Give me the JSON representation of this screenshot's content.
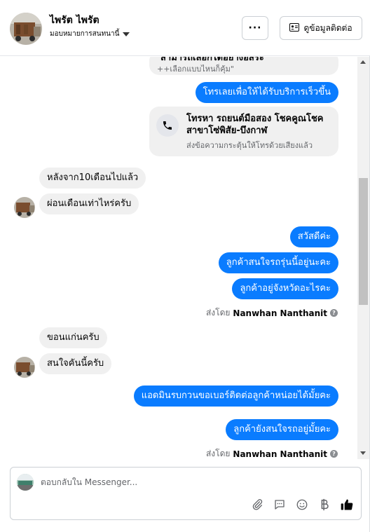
{
  "header": {
    "name": "ไพรัต ไพรัต",
    "assign_label": "มอบหมายการสนทนานี้",
    "more_label": "···",
    "contact_label": "ดูข้อมูลติดต่อ"
  },
  "messages": {
    "top_card": {
      "title_partial": "สามารถเลือกได้อย่างอิสระ",
      "subtitle": "++เลือกแบบไหนก็คุ้ม\""
    },
    "call_prompt": "โทรเลยเพื่อให้ได้รับบริการเร็วขึ้น",
    "call_card": {
      "title": "โทรหา รถยนต์มือสอง โชคคูณโชค สาขาโซ่พิสัย-บึงกาฬ",
      "subtitle": "ส่งข้อความกระตุ้นให้โทรด้วยเสียงแล้ว"
    },
    "incoming_1": [
      "หลังจาก10เดือนไปแล้ว",
      "ผ่อนเดือนเท่าไหร่ครับ"
    ],
    "outgoing_1": [
      "สวัสดีค่ะ",
      "ลูกค้าสนใจรถรุ่นนี้อยู่นะคะ",
      "ลูกค้าอยู่จังหวัดอะไรคะ"
    ],
    "sent_by_prefix": "ส่งโดย",
    "sent_by_name": "Nanwhan Nanthanit",
    "incoming_2": [
      "ขอนแก่นครับ",
      "สนใจคันนี้ครับ"
    ],
    "outgoing_2": [
      "แอดมินรบกวนขอเบอร์ติดต่อลูกค้าหน่อยได้มั้ยคะ",
      "ลูกค้ายังสนใจรถอยู่มั้ยคะ"
    ]
  },
  "composer": {
    "placeholder": "ตอบกลับใน Messenger..."
  },
  "colors": {
    "outgoing_bubble": "#0a7cff",
    "incoming_bubble": "#f0f0f0",
    "muted_text": "#65676b"
  }
}
